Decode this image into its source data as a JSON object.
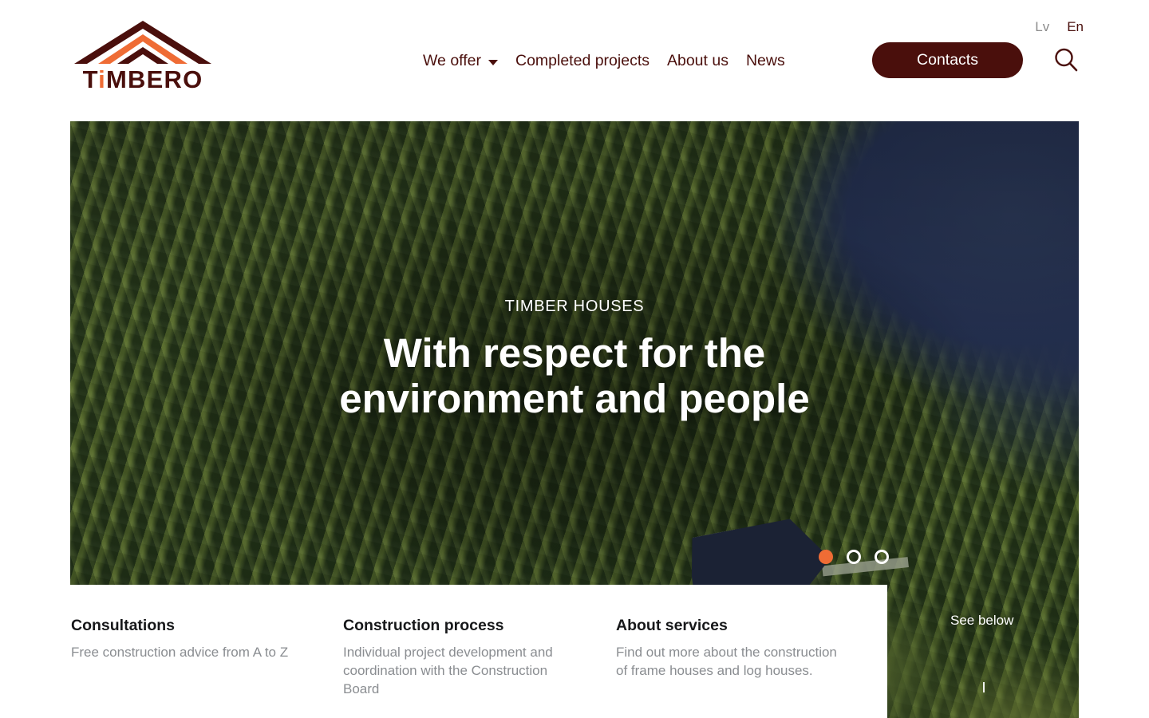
{
  "brand": {
    "name": "TIMBERO",
    "name_prefix": "T",
    "name_accent": "i",
    "name_suffix": "MBERO",
    "logo_icon": "chevron-roof-logo",
    "colors": {
      "dark": "#4a0f0c",
      "accent": "#ef6c35",
      "heading": "#17181a",
      "muted": "#8a8d91"
    }
  },
  "header": {
    "nav": [
      {
        "label": "We offer",
        "has_dropdown": true,
        "caret_icon": "chevron-down-icon"
      },
      {
        "label": "Completed projects",
        "has_dropdown": false
      },
      {
        "label": "About us",
        "has_dropdown": false
      },
      {
        "label": "News",
        "has_dropdown": false
      }
    ],
    "languages": [
      {
        "code": "Lv",
        "active": false
      },
      {
        "code": "En",
        "active": true
      }
    ],
    "contacts_label": "Contacts",
    "search_icon": "search-icon"
  },
  "hero": {
    "eyebrow": "TIMBER HOUSES",
    "title": "With respect for the environment and people",
    "see_below_label": "See below",
    "carousel": {
      "total_slides": 3,
      "active_index": 0,
      "dots": [
        {
          "active": true
        },
        {
          "active": false
        },
        {
          "active": false
        }
      ]
    },
    "image_description": "aerial-forest-with-lake-and-timber-house"
  },
  "features": [
    {
      "title": "Consultations",
      "text": "Free construction advice from A to Z"
    },
    {
      "title": "Construction process",
      "text": "Individual project development and coordination with the Construction Board"
    },
    {
      "title": "About services",
      "text": "Find out more about the construction of frame houses and log houses."
    }
  ]
}
